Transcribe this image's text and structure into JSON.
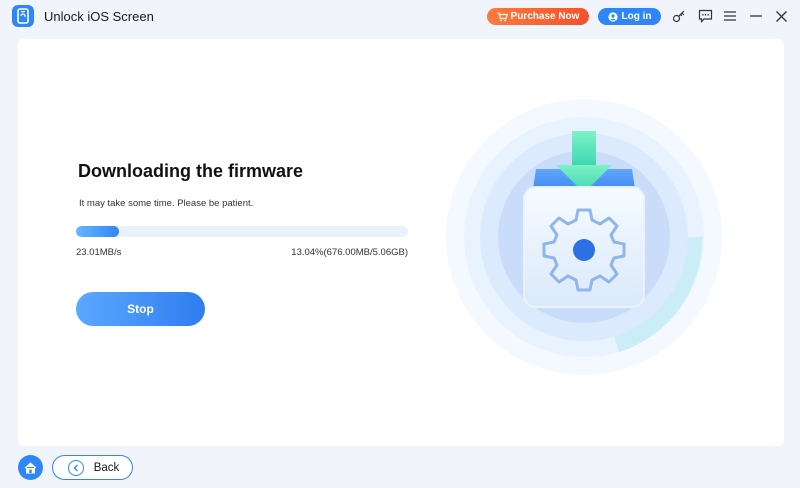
{
  "app": {
    "title": "Unlock iOS Screen",
    "logo_icon": "phone-unlock-icon"
  },
  "header": {
    "purchase_label": "Purchase Now",
    "login_label": "Log in",
    "icons": [
      "cart-icon",
      "user-icon",
      "key-icon",
      "feedback-icon",
      "menu-icon",
      "minimize-icon",
      "close-icon"
    ]
  },
  "main": {
    "heading": "Downloading the firmware",
    "subtext": "It may take some time. Please be patient.",
    "progress": {
      "percent_value": 13.04,
      "speed": "23.01MB/s",
      "size_info": "13.04%(676.00MB/5.06GB)"
    },
    "stop_label": "Stop",
    "illustration_icon": "firmware-download-gear-icon"
  },
  "footer": {
    "home_icon": "home-icon",
    "back_label": "Back"
  },
  "colors": {
    "accent": "#2f86f6",
    "purchase": "#f5502b",
    "background": "#f1f4fa",
    "card": "#ffffff"
  }
}
